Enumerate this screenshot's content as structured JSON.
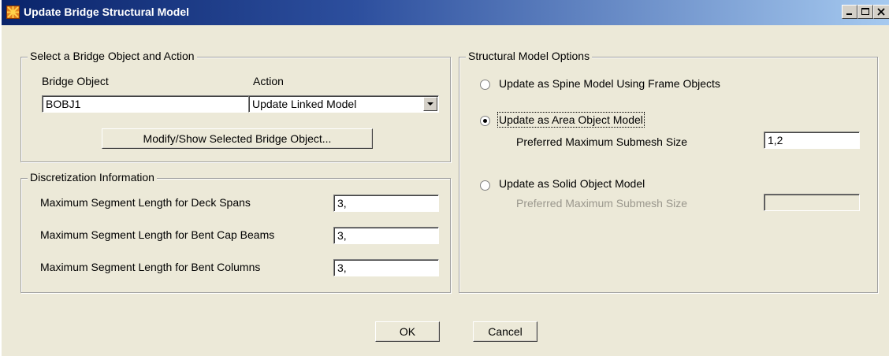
{
  "window": {
    "title": "Update Bridge Structural Model"
  },
  "select_group": {
    "title": "Select a Bridge Object and Action",
    "bridge_object_label": "Bridge Object",
    "bridge_object_value": "BOBJ1",
    "action_label": "Action",
    "action_value": "Update Linked Model",
    "modify_button": "Modify/Show Selected Bridge Object..."
  },
  "discretization": {
    "title": "Discretization Information",
    "rows": [
      {
        "label": "Maximum Segment Length for Deck Spans",
        "value": "3,"
      },
      {
        "label": "Maximum Segment Length for Bent Cap Beams",
        "value": "3,"
      },
      {
        "label": "Maximum Segment Length for Bent Columns",
        "value": "3,"
      }
    ]
  },
  "structural": {
    "title": "Structural Model Options",
    "option_spine": "Update as Spine Model Using Frame Objects",
    "option_area": "Update as Area Object Model",
    "option_area_submesh_label": "Preferred Maximum Submesh Size",
    "option_area_submesh_value": "1,2",
    "option_solid": "Update as Solid Object Model",
    "option_solid_submesh_label": "Preferred Maximum Submesh Size",
    "option_solid_submesh_value": "",
    "selected": "area"
  },
  "buttons": {
    "ok": "OK",
    "cancel": "Cancel"
  }
}
